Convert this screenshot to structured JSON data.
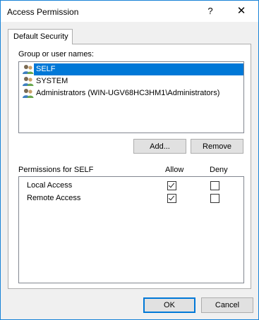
{
  "window": {
    "title": "Access Permission",
    "help_glyph": "?",
    "close_glyph": "✕"
  },
  "tabs": [
    {
      "label": "Default Security"
    }
  ],
  "group_label": "Group or user names:",
  "users": [
    {
      "name": "SELF",
      "selected": true
    },
    {
      "name": "SYSTEM",
      "selected": false
    },
    {
      "name": "Administrators (WIN-UGV68HC3HM1\\Administrators)",
      "selected": false
    }
  ],
  "buttons": {
    "add": "Add...",
    "remove": "Remove",
    "ok": "OK",
    "cancel": "Cancel"
  },
  "permissions": {
    "header": "Permissions for SELF",
    "allow_header": "Allow",
    "deny_header": "Deny",
    "rows": [
      {
        "name": "Local Access",
        "allow": true,
        "deny": false
      },
      {
        "name": "Remote Access",
        "allow": true,
        "deny": false
      }
    ]
  },
  "colors": {
    "accent": "#0078d7",
    "window_border": "#1883d7"
  }
}
